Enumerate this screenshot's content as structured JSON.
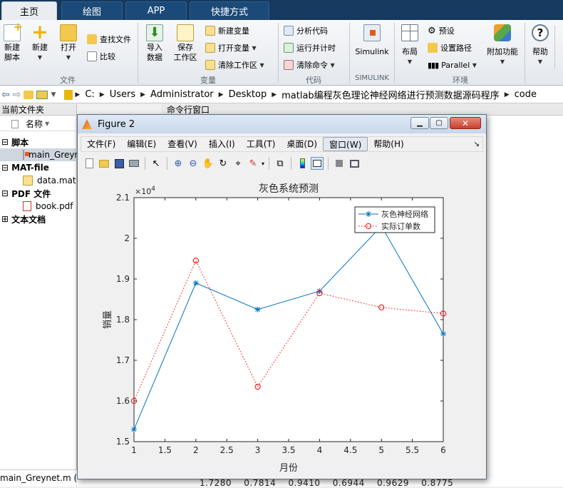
{
  "tabs": [
    {
      "label": "主页"
    },
    {
      "label": "绘图"
    },
    {
      "label": "APP"
    },
    {
      "label": "快捷方式"
    }
  ],
  "ribbon": {
    "new_script": "新建\n脚本",
    "new": "新建",
    "open": "打开",
    "find_files": "查找文件",
    "compare": "比较",
    "import_data": "导入\n数据",
    "save_workspace": "保存\n工作区",
    "new_variable": "新建变量",
    "open_variable": "打开变量",
    "clear_workspace": "清除工作区",
    "analyze_code": "分析代码",
    "run_and_time": "运行并计时",
    "clear_commands": "清除命令",
    "simulink": "Simulink",
    "layout": "布局",
    "preferences": "预设",
    "set_path": "设置路径",
    "parallel": "Parallel",
    "addons": "附加功能",
    "help": "帮助",
    "groups": {
      "file": "文件",
      "variable": "变量",
      "code": "代码",
      "simulink": "SIMULINK",
      "environment": "环境"
    }
  },
  "address": {
    "crumbs": [
      "C:",
      "Users",
      "Administrator",
      "Desktop",
      "matlab编程灰色理论神经网络进行预测数据源码程序",
      "code"
    ]
  },
  "left_panel": {
    "title": "当前文件夹",
    "column": "名称",
    "groups": [
      {
        "label": "脚本",
        "files": [
          "main_Greynet.m"
        ]
      },
      {
        "label": "MAT-file",
        "files": [
          "data.mat"
        ]
      },
      {
        "label": "PDF 文件",
        "files": [
          "book.pdf"
        ]
      },
      {
        "label": "文本文档",
        "files": []
      }
    ],
    "status_file": "main_Greynet.m  (脚本)"
  },
  "command_window": {
    "title": "命令行窗口",
    "bottom_values": "1.7280    0.7814    0.9410    0.6944    0.9629    0.8775"
  },
  "figure": {
    "title": "Figure 2",
    "menu": [
      "文件(F)",
      "编辑(E)",
      "查看(V)",
      "插入(I)",
      "工具(T)",
      "桌面(D)",
      "窗口(W)",
      "帮助(H)"
    ]
  },
  "chart_data": {
    "type": "line",
    "title": "灰色系统预测",
    "xlabel": "月份",
    "ylabel": "销量",
    "exponent_label": "×10",
    "exponent_power": "4",
    "x": [
      1,
      2,
      3,
      4,
      5,
      6
    ],
    "xlim": [
      1,
      6
    ],
    "ylim": [
      1.5,
      2.1
    ],
    "xticks": [
      "1",
      "1.5",
      "2",
      "2.5",
      "3",
      "3.5",
      "4",
      "4.5",
      "5",
      "5.5",
      "6"
    ],
    "yticks": [
      "1.5",
      "1.6",
      "1.7",
      "1.8",
      "1.9",
      "2",
      "2.1"
    ],
    "legend_position": "top-right",
    "series": [
      {
        "name": "灰色神经网络",
        "values": [
          1.53,
          1.89,
          1.825,
          1.87,
          2.03,
          1.765
        ],
        "color": "#0072bd",
        "marker": "asterisk",
        "line": "solid"
      },
      {
        "name": "实际订单数",
        "values": [
          1.6,
          1.945,
          1.635,
          1.865,
          1.83,
          1.815
        ],
        "color": "#ff0000",
        "marker": "circle",
        "line": "dotted"
      }
    ]
  }
}
